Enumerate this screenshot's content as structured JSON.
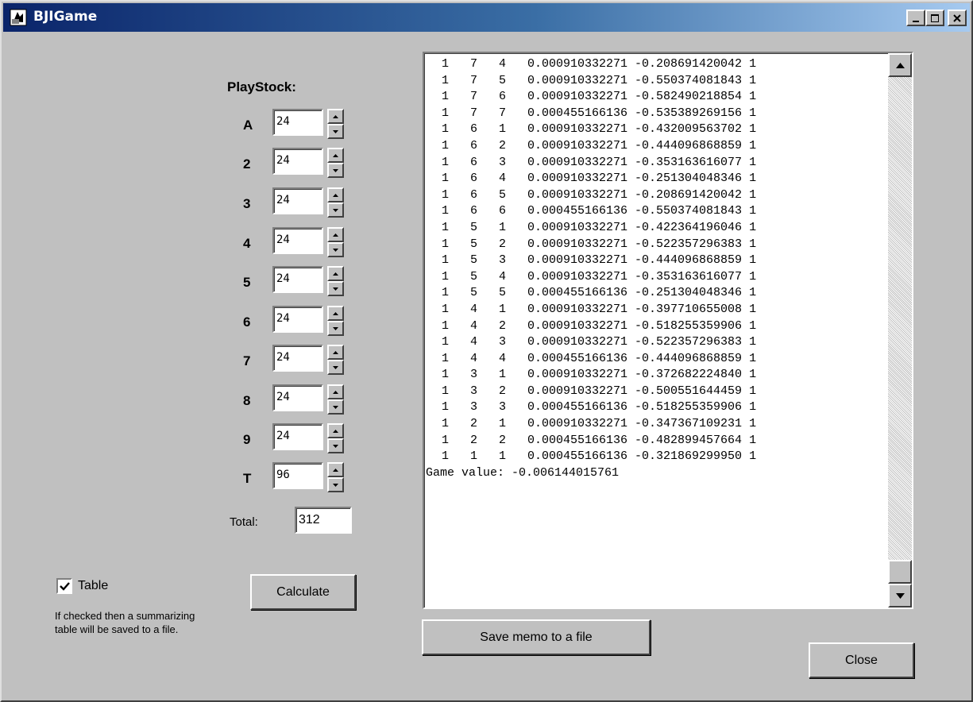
{
  "window": {
    "title": "BJIGame"
  },
  "playstock": {
    "heading": "PlayStock:",
    "rows": [
      {
        "label": "A",
        "value": "24"
      },
      {
        "label": "2",
        "value": "24"
      },
      {
        "label": "3",
        "value": "24"
      },
      {
        "label": "4",
        "value": "24"
      },
      {
        "label": "5",
        "value": "24"
      },
      {
        "label": "6",
        "value": "24"
      },
      {
        "label": "7",
        "value": "24"
      },
      {
        "label": "8",
        "value": "24"
      },
      {
        "label": "9",
        "value": "24"
      },
      {
        "label": "T",
        "value": "96"
      }
    ],
    "total_label": "Total:",
    "total_value": "312"
  },
  "options": {
    "table_label": "Table",
    "table_checked": true,
    "help_line1": "If checked then a summarizing",
    "help_line2": "table will be saved to a file."
  },
  "buttons": {
    "calculate": "Calculate",
    "save_memo": "Save memo to a file",
    "close": "Close"
  },
  "memo": {
    "rows": [
      [
        "1",
        "7",
        "4",
        "0.000910332271",
        "-0.208691420042",
        "1"
      ],
      [
        "1",
        "7",
        "5",
        "0.000910332271",
        "-0.550374081843",
        "1"
      ],
      [
        "1",
        "7",
        "6",
        "0.000910332271",
        "-0.582490218854",
        "1"
      ],
      [
        "1",
        "7",
        "7",
        "0.000455166136",
        "-0.535389269156",
        "1"
      ],
      [
        "1",
        "6",
        "1",
        "0.000910332271",
        "-0.432009563702",
        "1"
      ],
      [
        "1",
        "6",
        "2",
        "0.000910332271",
        "-0.444096868859",
        "1"
      ],
      [
        "1",
        "6",
        "3",
        "0.000910332271",
        "-0.353163616077",
        "1"
      ],
      [
        "1",
        "6",
        "4",
        "0.000910332271",
        "-0.251304048346",
        "1"
      ],
      [
        "1",
        "6",
        "5",
        "0.000910332271",
        "-0.208691420042",
        "1"
      ],
      [
        "1",
        "6",
        "6",
        "0.000455166136",
        "-0.550374081843",
        "1"
      ],
      [
        "1",
        "5",
        "1",
        "0.000910332271",
        "-0.422364196046",
        "1"
      ],
      [
        "1",
        "5",
        "2",
        "0.000910332271",
        "-0.522357296383",
        "1"
      ],
      [
        "1",
        "5",
        "3",
        "0.000910332271",
        "-0.444096868859",
        "1"
      ],
      [
        "1",
        "5",
        "4",
        "0.000910332271",
        "-0.353163616077",
        "1"
      ],
      [
        "1",
        "5",
        "5",
        "0.000455166136",
        "-0.251304048346",
        "1"
      ],
      [
        "1",
        "4",
        "1",
        "0.000910332271",
        "-0.397710655008",
        "1"
      ],
      [
        "1",
        "4",
        "2",
        "0.000910332271",
        "-0.518255359906",
        "1"
      ],
      [
        "1",
        "4",
        "3",
        "0.000910332271",
        "-0.522357296383",
        "1"
      ],
      [
        "1",
        "4",
        "4",
        "0.000455166136",
        "-0.444096868859",
        "1"
      ],
      [
        "1",
        "3",
        "1",
        "0.000910332271",
        "-0.372682224840",
        "1"
      ],
      [
        "1",
        "3",
        "2",
        "0.000910332271",
        "-0.500551644459",
        "1"
      ],
      [
        "1",
        "3",
        "3",
        "0.000455166136",
        "-0.518255359906",
        "1"
      ],
      [
        "1",
        "2",
        "1",
        "0.000910332271",
        "-0.347367109231",
        "1"
      ],
      [
        "1",
        "2",
        "2",
        "0.000455166136",
        "-0.482899457664",
        "1"
      ],
      [
        "1",
        "1",
        "1",
        "0.000455166136",
        "-0.321869299950",
        "1"
      ]
    ],
    "game_value_line": "Game value: -0.006144015761"
  },
  "icons": {
    "app": "bjigame-app-icon",
    "minimize": "minimize-icon",
    "maximize": "maximize-icon",
    "close": "close-icon",
    "spin_up": "spin-up-arrow-icon",
    "spin_down": "spin-down-arrow-icon",
    "scroll_up": "scroll-up-arrow-icon",
    "scroll_down": "scroll-down-arrow-icon",
    "check": "checkmark-icon"
  },
  "colors": {
    "titlebar_start": "#0a246a",
    "titlebar_end": "#a6caf0",
    "face": "#c0c0c0"
  }
}
